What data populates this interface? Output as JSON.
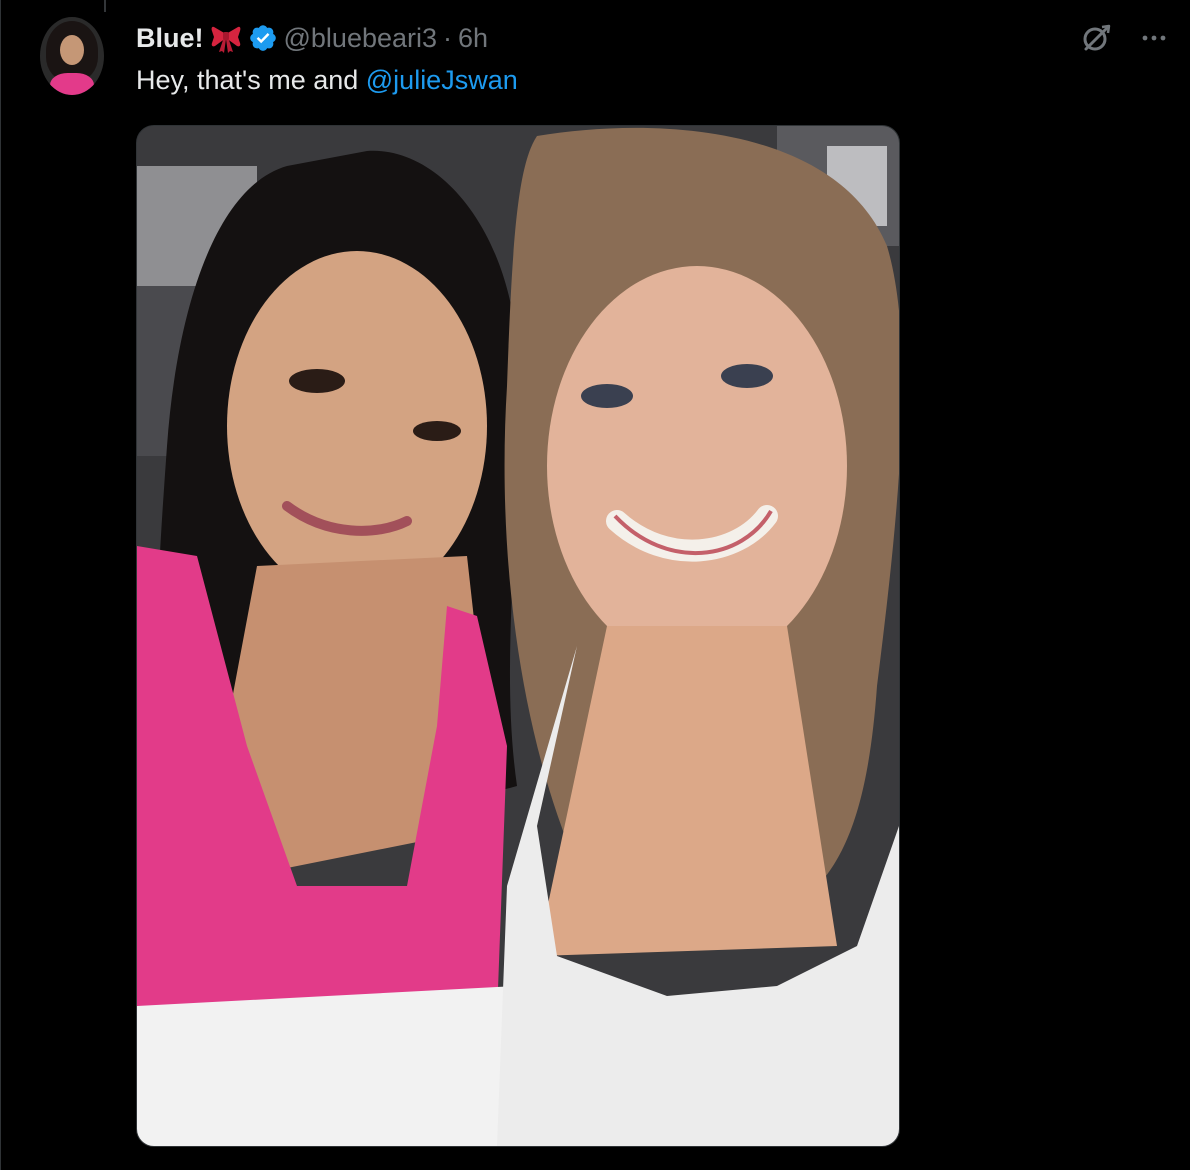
{
  "tweet": {
    "display_name": "Blue!",
    "handle": "@bluebeari3",
    "separator": "·",
    "time": "6h",
    "text_prefix": "Hey, that's me and ",
    "mention": "@julieJswan",
    "icons": {
      "name_emoji": "ribbon-bow-icon",
      "verified": "verified-badge-icon",
      "grok": "grok-icon",
      "more": "more-icon"
    }
  },
  "colors": {
    "background": "#000000",
    "text_primary": "#e7e9ea",
    "text_secondary": "#71767b",
    "link": "#1d9bf0",
    "verified": "#1d9bf0"
  }
}
